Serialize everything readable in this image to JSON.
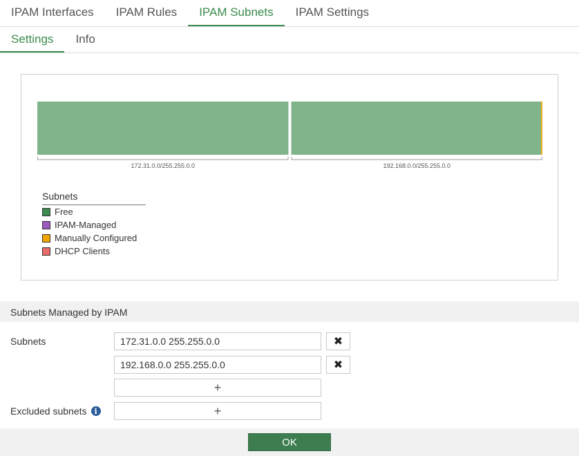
{
  "top_tabs": [
    {
      "label": "IPAM Interfaces"
    },
    {
      "label": "IPAM Rules"
    },
    {
      "label": "IPAM Subnets"
    },
    {
      "label": "IPAM Settings"
    }
  ],
  "sub_tabs": [
    {
      "label": "Settings"
    },
    {
      "label": "Info"
    }
  ],
  "colors": {
    "accent": "#3a8a4a",
    "free": "#81b48a",
    "ipam_managed": "#9b59c0",
    "manually_configured": "#f0a500",
    "dhcp_clients": "#e86b6b"
  },
  "chart_data": {
    "type": "bar",
    "stacked": "horizontal",
    "categories": [
      "172.31.0.0/255.255.0.0",
      "192.168.0.0/255.255.0.0"
    ],
    "series": [
      {
        "name": "Free",
        "values": [
          100,
          99.5
        ]
      },
      {
        "name": "IPAM-Managed",
        "values": [
          0,
          0
        ]
      },
      {
        "name": "Manually Configured",
        "values": [
          0,
          0.5
        ]
      },
      {
        "name": "DHCP Clients",
        "values": [
          0,
          0
        ]
      }
    ],
    "legend_title": "Subnets",
    "legend": [
      "Free",
      "IPAM-Managed",
      "Manually Configured",
      "DHCP Clients"
    ],
    "legend_placement": "bottom-left"
  },
  "section": {
    "title": "Subnets Managed by IPAM",
    "subnets_label": "Subnets",
    "subnets": [
      "172.31.0.0 255.255.0.0",
      "192.168.0.0 255.255.0.0"
    ],
    "add_symbol": "+",
    "delete_symbol": "✖",
    "excluded_label": "Excluded subnets",
    "info_symbol": "i"
  },
  "footer": {
    "ok_label": "OK"
  }
}
